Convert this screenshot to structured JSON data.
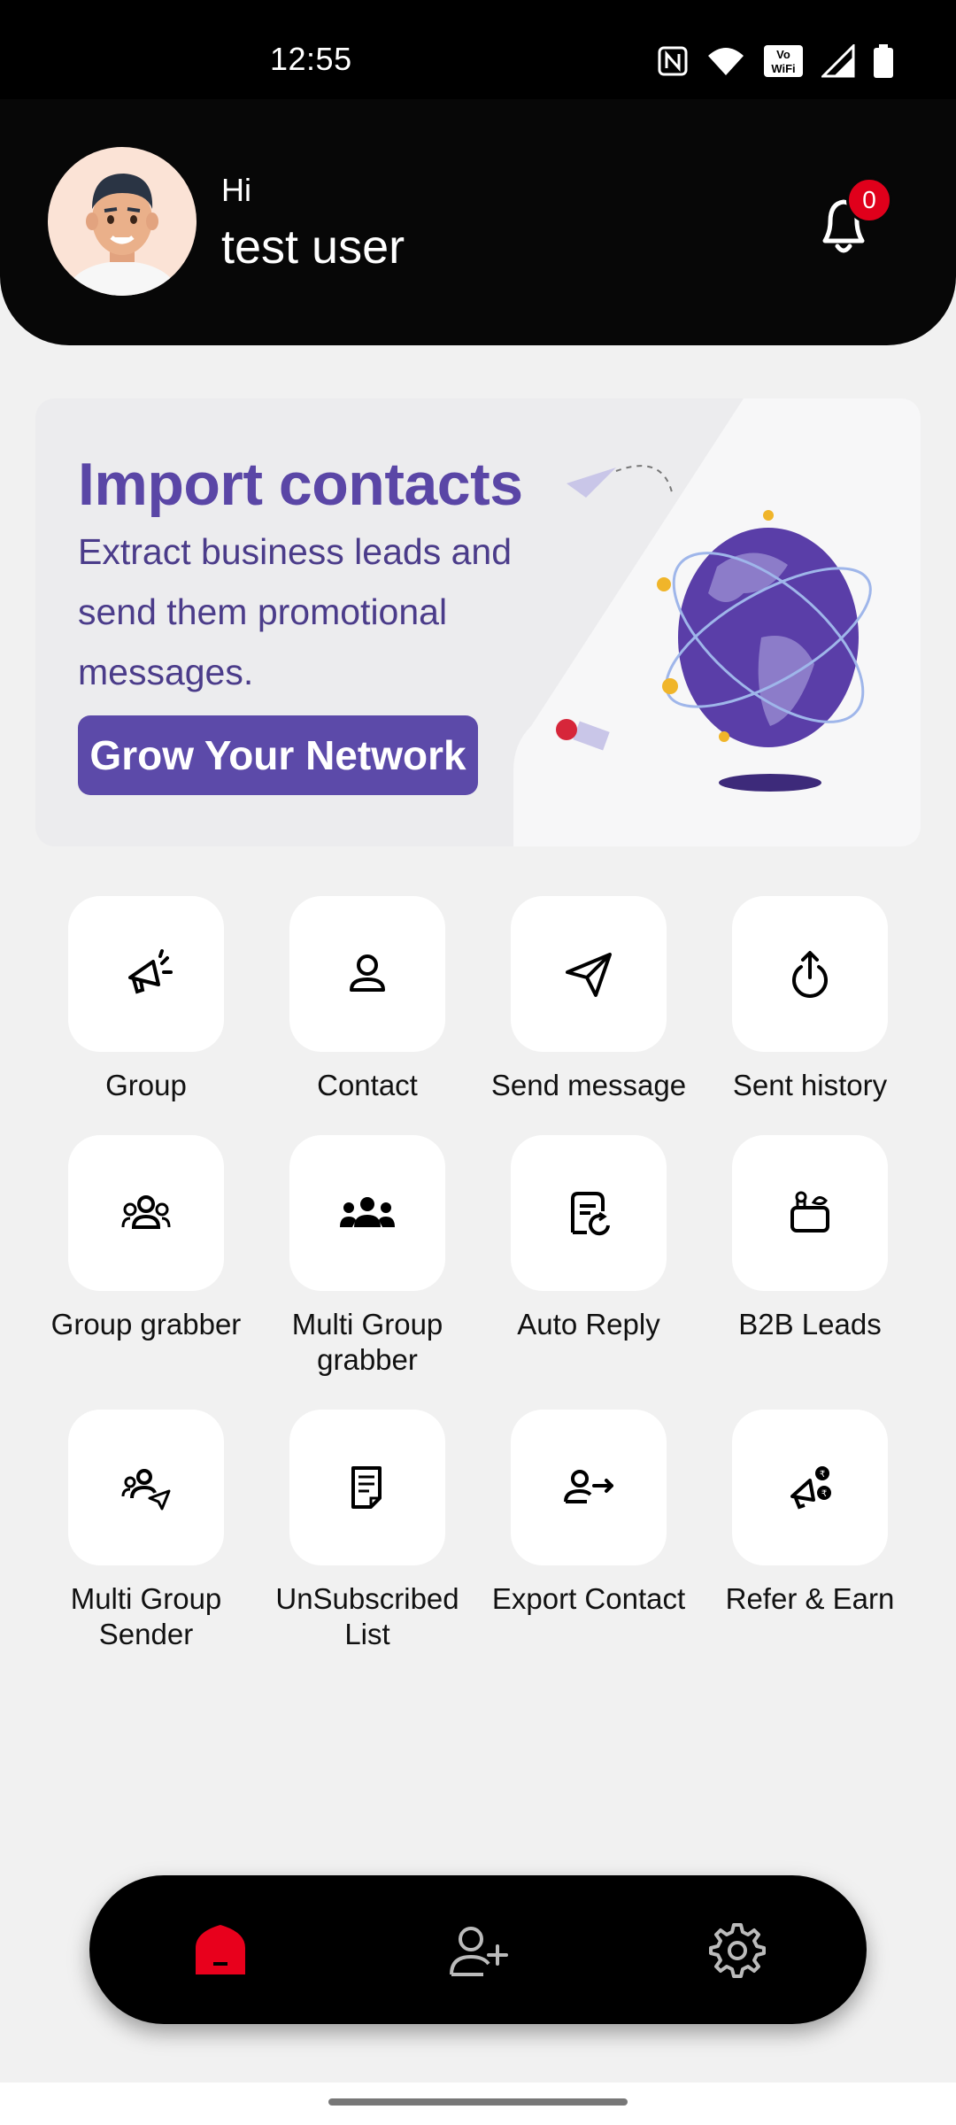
{
  "status_bar": {
    "time": "12:55"
  },
  "header": {
    "greeting": "Hi",
    "username": "test user",
    "notification_count": "0"
  },
  "banner": {
    "title": "Import contacts",
    "line1": "Extract business leads and",
    "line2": "send them promotional",
    "line3": "messages.",
    "button_label": "Grow Your Network"
  },
  "tiles": [
    {
      "label1": "Group",
      "label2": "",
      "icon": "megaphone-icon"
    },
    {
      "label1": "Contact",
      "label2": "",
      "icon": "person-icon"
    },
    {
      "label1": "Send message",
      "label2": "",
      "icon": "paper-plane-icon"
    },
    {
      "label1": "Sent history",
      "label2": "",
      "icon": "history-icon"
    },
    {
      "label1": "Group grabber",
      "label2": "",
      "icon": "group-icon"
    },
    {
      "label1": "Multi Group",
      "label2": "grabber",
      "icon": "multi-group-icon"
    },
    {
      "label1": "Auto Reply",
      "label2": "",
      "icon": "auto-reply-icon"
    },
    {
      "label1": "B2B Leads",
      "label2": "",
      "icon": "briefcase-icon"
    },
    {
      "label1": "Multi Group",
      "label2": "Sender",
      "icon": "group-send-icon"
    },
    {
      "label1": "UnSubscribed",
      "label2": "List",
      "icon": "document-icon"
    },
    {
      "label1": "Export Contact",
      "label2": "",
      "icon": "export-contact-icon"
    },
    {
      "label1": "Refer & Earn",
      "label2": "",
      "icon": "refer-icon"
    }
  ],
  "nav": {
    "items": [
      "home-icon",
      "add-user-icon",
      "settings-icon"
    ],
    "active_color": "#e8001c"
  }
}
